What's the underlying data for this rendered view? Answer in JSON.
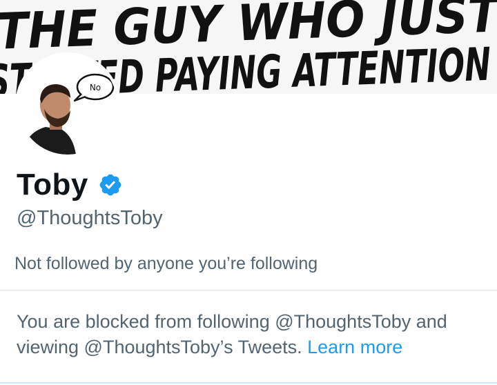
{
  "banner": {
    "line1": "THE GUY WHO JUST",
    "line2": "STARTED PAYING ATTENTION"
  },
  "avatar": {
    "speech_bubble": "No"
  },
  "profile": {
    "name": "Toby",
    "handle": "@ThoughtsToby",
    "verified": true,
    "followed_by": "Not followed by anyone you’re following"
  },
  "blocked_notice": {
    "text": "You are blocked from following @ThoughtsToby and viewing @ThoughtsToby’s Tweets.",
    "link": "Learn more"
  },
  "colors": {
    "text_primary": "#0f1419",
    "text_secondary": "#536471",
    "accent": "#1d9bf0",
    "divider": "#dcdfe2"
  },
  "icons": {
    "verified": "verified-badge-icon"
  }
}
